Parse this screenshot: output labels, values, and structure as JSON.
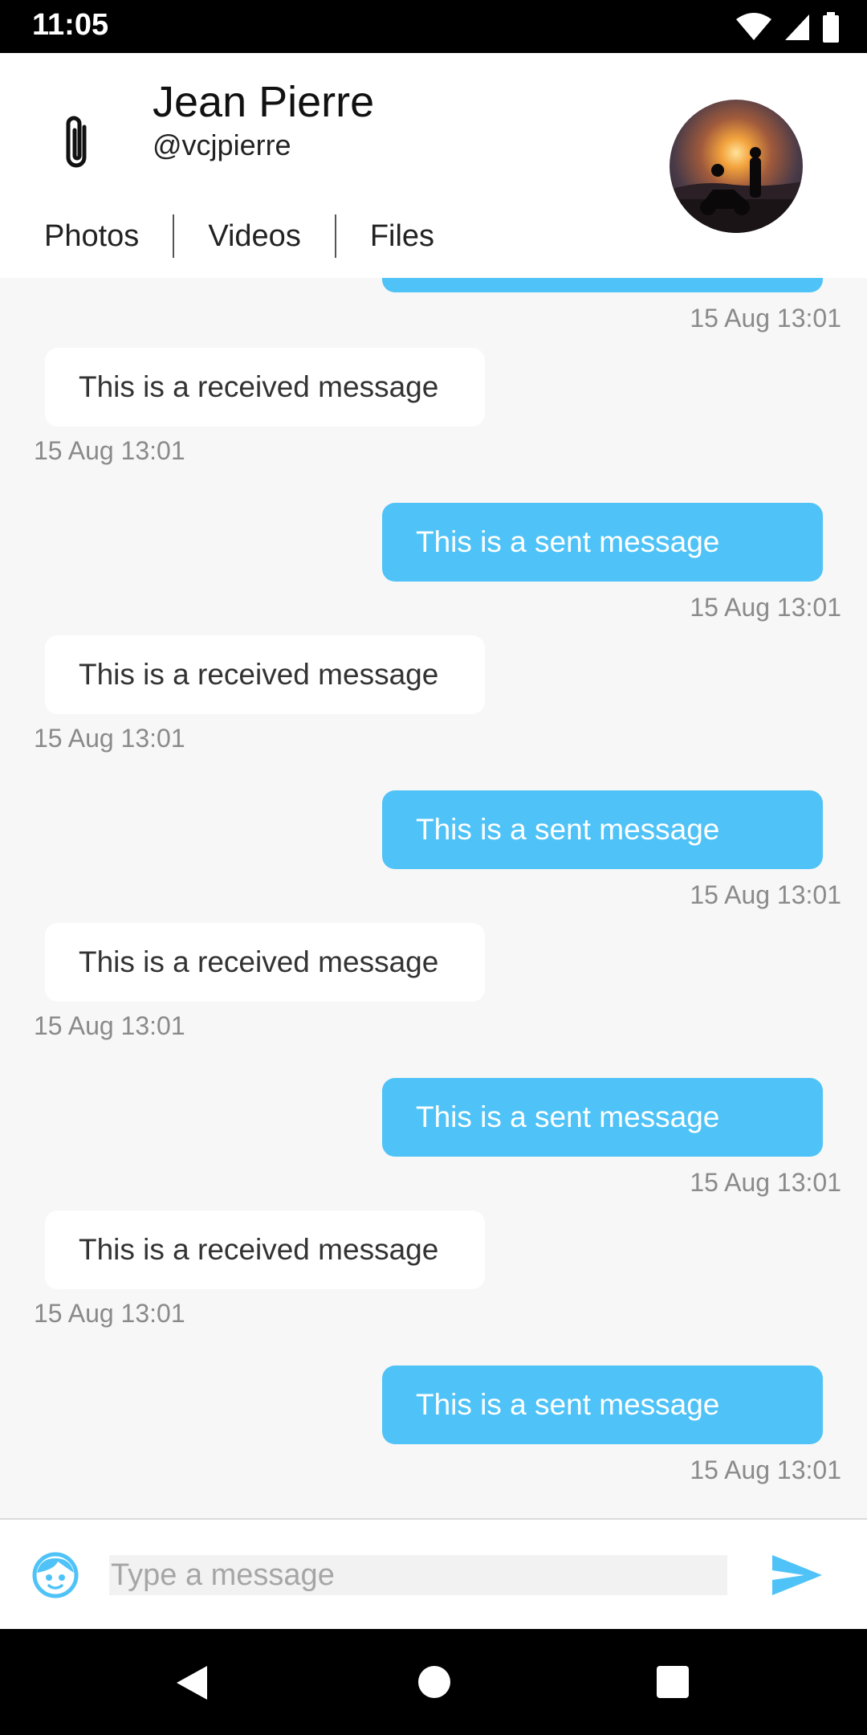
{
  "status_bar": {
    "time": "11:05",
    "icons": [
      "wifi-icon",
      "signal-icon",
      "battery-icon"
    ]
  },
  "header": {
    "name": "Jean Pierre",
    "handle": "@vcjpierre",
    "tabs": [
      "Photos",
      "Videos",
      "Files"
    ]
  },
  "messages": [
    {
      "type": "sent",
      "text": "",
      "time": "15 Aug 13:01"
    },
    {
      "type": "received",
      "text": "This is a received message",
      "time": "15 Aug 13:01"
    },
    {
      "type": "sent",
      "text": "This is a sent message",
      "time": "15 Aug 13:01"
    },
    {
      "type": "received",
      "text": "This is a received message",
      "time": "15 Aug 13:01"
    },
    {
      "type": "sent",
      "text": "This is a sent message",
      "time": "15 Aug 13:01"
    },
    {
      "type": "received",
      "text": "This is a received message",
      "time": "15 Aug 13:01"
    },
    {
      "type": "sent",
      "text": "This is a sent message",
      "time": "15 Aug 13:01"
    },
    {
      "type": "received",
      "text": "This is a received message",
      "time": "15 Aug 13:01"
    },
    {
      "type": "sent",
      "text": "This is a sent message",
      "time": "15 Aug 13:01"
    }
  ],
  "composer": {
    "placeholder": "Type a message",
    "value": ""
  },
  "colors": {
    "accent": "#4fc3f7",
    "background": "#f7f7f7",
    "received_bubble": "#ffffff"
  },
  "nav_bar": {
    "icons": [
      "back-icon",
      "home-icon",
      "recents-icon"
    ]
  }
}
